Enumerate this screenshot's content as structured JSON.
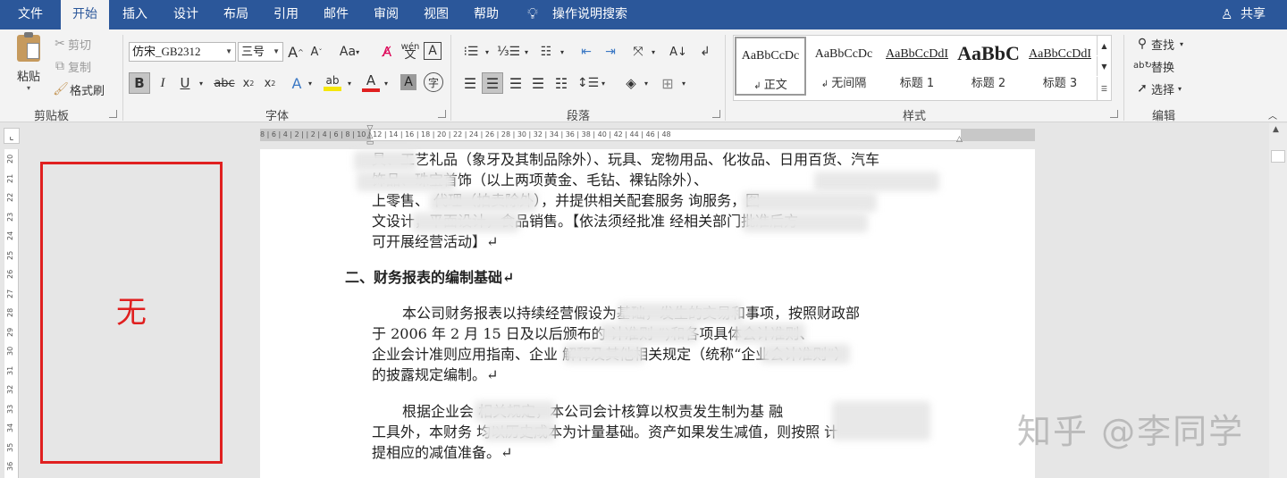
{
  "tabs": {
    "file": "文件",
    "home": "开始",
    "insert": "插入",
    "design": "设计",
    "layout": "布局",
    "references": "引用",
    "mailings": "邮件",
    "review": "审阅",
    "view": "视图",
    "help": "帮助",
    "tell_me": "操作说明搜索",
    "share": "共享"
  },
  "clipboard": {
    "paste": "粘贴",
    "cut": "剪切",
    "copy": "复制",
    "format_painter": "格式刷",
    "group": "剪贴板"
  },
  "font": {
    "name": "仿宋_GB2312",
    "size": "三号",
    "group": "字体"
  },
  "paragraph": {
    "group": "段落"
  },
  "styles": {
    "group": "样式",
    "items": [
      {
        "sample": "AaBbCcDc",
        "name": "正文"
      },
      {
        "sample": "AaBbCcDc",
        "name": "无间隔"
      },
      {
        "sample": "AaBbCcDdI",
        "name": "标题 1"
      },
      {
        "sample": "AaBbC",
        "name": "标题 2"
      },
      {
        "sample": "AaBbCcDdI",
        "name": "标题 3"
      }
    ]
  },
  "editing": {
    "find": "查找",
    "replace": "替换",
    "select": "选择",
    "group": "编辑"
  },
  "ruler": {
    "h": "8 | 6 | 4 | 2 | | 2 | 4 | 6 | 8 | 10 | 12 | 14 | 16 | 18 | 20 | 22 | 24 | 26 | 28 | 30 | 32 | 34 | 36 | 38 | 40 | 42 | 44 | 46 | 48",
    "v": [
      "20",
      "21",
      "22",
      "23",
      "24",
      "25",
      "26",
      "27",
      "28",
      "29",
      "30",
      "31",
      "32",
      "33",
      "34",
      "35",
      "36"
    ]
  },
  "annotation": {
    "label": "无"
  },
  "document": {
    "lines1": [
      "具、工艺礼品（象牙及其制品除外）、玩具、宠物用品、化妆品、日用百货、汽车",
      "饰品、珠宝首饰（以上两项黄金、毛钻、裸钻除外）、",
      "上零售、       代理（拍卖除外），并提供相关配套服务    询服务，图",
      "文设计，平面设计，食品销售。【依法须经批准    经相关部门批准后方",
      "可开展经营活动】↵"
    ],
    "heading": "二、财务报表的编制基础↵",
    "para2": [
      "本公司财务报表以持续经营假设为基础，发生的交易和事项，按照财政部",
      "于 2006 年 2 月 15 日及以后颁布的    计准则    ”)和各项具体会计准则、",
      "企业会计准则应用指南、企业    解释及其他相关规定（统称“企业会计准则”）",
      "的披露规定编制。↵"
    ],
    "para3": [
      "根据企业会    相关规定，本公司会计核算以权责发生制为基     融",
      "工具外，本财务    均以历史成本为计量基础。资产如果发生减值，则按照    计",
      "提相应的减值准备。↵"
    ]
  },
  "watermark": "知乎 @李同学",
  "colors": {
    "accent": "#2b579a",
    "annotation": "#e02020",
    "highlight_yellow": "#f5e60a",
    "font_red": "#e02020"
  }
}
